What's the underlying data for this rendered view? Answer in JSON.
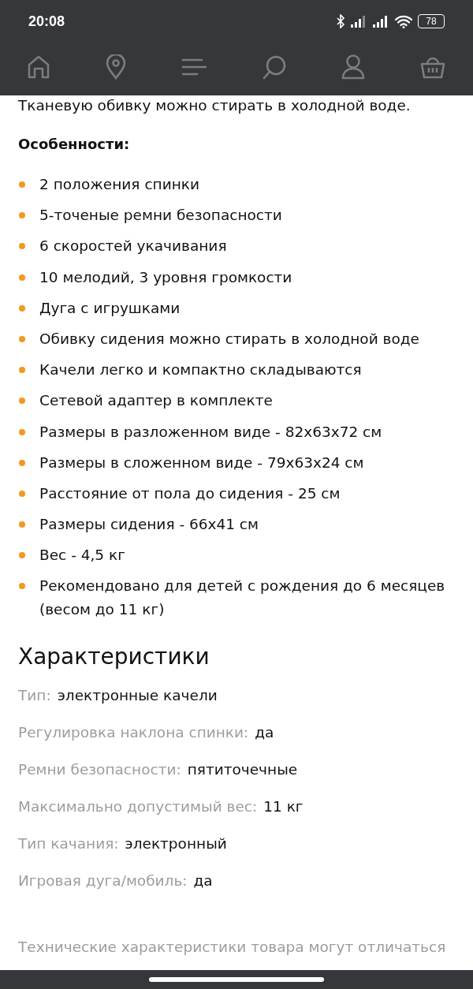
{
  "status_bar": {
    "time": "20:08",
    "battery": "78"
  },
  "nav_bar": {
    "items": [
      {
        "kind": "home"
      },
      {
        "kind": "location"
      },
      {
        "kind": "menu"
      },
      {
        "kind": "search"
      },
      {
        "kind": "profile"
      },
      {
        "kind": "cart"
      }
    ]
  },
  "intro": "Тканевую обивку можно стирать в холодной воде.",
  "features": {
    "title": "Особенности:",
    "items": [
      "2 положения спинки",
      "5-точеные ремни безопасности",
      "6 скоростей укачивания",
      "10 мелодий, 3 уровня громкости",
      "Дуга с игрушками",
      "Обивку сидения можно стирать в холодной воде",
      "Качели легко и компактно складываются",
      "Сетевой адаптер в комплекте",
      "Размеры в разложенном виде - 82х63х72 см",
      "Размеры в сложенном виде - 79х63х24 см",
      "Расстояние от пола до сидения - 25 см",
      "Размеры сидения - 66х41 см",
      "Вес - 4,5 кг",
      "Рекомендовано для детей с рождения до 6 месяцев (весом до 11 кг)"
    ]
  },
  "specs": {
    "title": "Характеристики",
    "rows": [
      {
        "label": "Тип:",
        "value": "электронные качели"
      },
      {
        "label": "Регулировка наклона спинки:",
        "value": "да"
      },
      {
        "label": "Ремни безопасности:",
        "value": "пятиточечные"
      },
      {
        "label": "Максимально допустимый вес:",
        "value": "11 кг"
      },
      {
        "label": "Тип качания:",
        "value": "электронный"
      },
      {
        "label": "Игровая дуга/мобиль:",
        "value": "да"
      }
    ]
  },
  "disclaimer": "Технические характеристики товара могут отличаться"
}
